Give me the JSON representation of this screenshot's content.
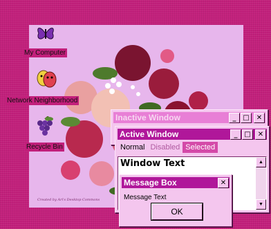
{
  "colors": {
    "desktop": "#c21f7b",
    "active_title": "#b0179a",
    "inactive_title": "#e87fd6",
    "selected": "#d44aa8"
  },
  "wallpaper": {
    "credit": "Created by Ari's Desktop Commons"
  },
  "desktop_icons": [
    {
      "label": "My Computer",
      "icon": "butterfly-icon"
    },
    {
      "label": "Network Neighborhood",
      "icon": "theater-masks-icon"
    },
    {
      "label": "Recycle Bin",
      "icon": "grapes-icon"
    }
  ],
  "inactive_window": {
    "title": "Inactive Window"
  },
  "active_window": {
    "title": "Active Window",
    "menu": {
      "normal": "Normal",
      "disabled": "Disabled",
      "selected": "Selected"
    },
    "window_text": "Window Text"
  },
  "message_box": {
    "title": "Message Box",
    "text": "Message Text",
    "ok_label": "OK"
  },
  "title_buttons": {
    "minimize": "_",
    "maximize": "□",
    "close": "✕"
  }
}
